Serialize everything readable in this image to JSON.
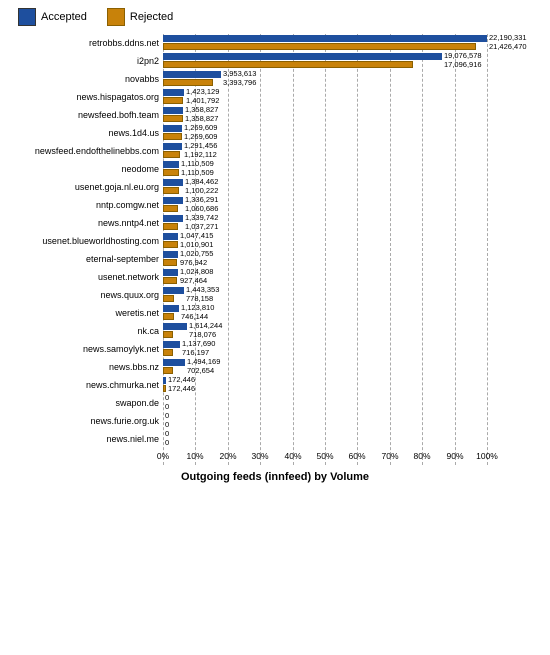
{
  "legend": {
    "accepted_label": "Accepted",
    "accepted_color": "#1e4f9e",
    "rejected_label": "Rejected",
    "rejected_color": "#c8820a"
  },
  "chart_title": "Outgoing feeds (innfeed) by Volume",
  "max_value": 22190331,
  "rows": [
    {
      "label": "retrobbs.ddns.net",
      "accepted": 22190331,
      "rejected": 21426470
    },
    {
      "label": "i2pn2",
      "accepted": 19076578,
      "rejected": 17096916
    },
    {
      "label": "novabbs",
      "accepted": 3953613,
      "rejected": 3393796
    },
    {
      "label": "news.hispagatos.org",
      "accepted": 1423129,
      "rejected": 1401792
    },
    {
      "label": "newsfeed.bofh.team",
      "accepted": 1358827,
      "rejected": 1358827
    },
    {
      "label": "news.1d4.us",
      "accepted": 1269609,
      "rejected": 1269609
    },
    {
      "label": "newsfeed.endofthelinebbs.com",
      "accepted": 1291456,
      "rejected": 1192112
    },
    {
      "label": "neodome",
      "accepted": 1110509,
      "rejected": 1110509
    },
    {
      "label": "usenet.goja.nl.eu.org",
      "accepted": 1384462,
      "rejected": 1100222
    },
    {
      "label": "nntp.comgw.net",
      "accepted": 1336291,
      "rejected": 1060686
    },
    {
      "label": "news.nntp4.net",
      "accepted": 1339742,
      "rejected": 1037271
    },
    {
      "label": "usenet.blueworldhosting.com",
      "accepted": 1047415,
      "rejected": 1010901
    },
    {
      "label": "eternal-september",
      "accepted": 1020755,
      "rejected": 976942
    },
    {
      "label": "usenet.network",
      "accepted": 1024808,
      "rejected": 927464
    },
    {
      "label": "news.quux.org",
      "accepted": 1443353,
      "rejected": 778158
    },
    {
      "label": "weretis.net",
      "accepted": 1123810,
      "rejected": 746144
    },
    {
      "label": "nk.ca",
      "accepted": 1614244,
      "rejected": 718076
    },
    {
      "label": "news.samoylyk.net",
      "accepted": 1137690,
      "rejected": 716197
    },
    {
      "label": "news.bbs.nz",
      "accepted": 1494169,
      "rejected": 702654
    },
    {
      "label": "news.chmurka.net",
      "accepted": 172446,
      "rejected": 172446
    },
    {
      "label": "swapon.de",
      "accepted": 0,
      "rejected": 0
    },
    {
      "label": "news.furie.org.uk",
      "accepted": 0,
      "rejected": 0
    },
    {
      "label": "news.niel.me",
      "accepted": 0,
      "rejected": 0
    }
  ],
  "x_axis_labels": [
    "0%",
    "10%",
    "20%",
    "30%",
    "40%",
    "50%",
    "60%",
    "70%",
    "80%",
    "90%",
    "100%"
  ]
}
